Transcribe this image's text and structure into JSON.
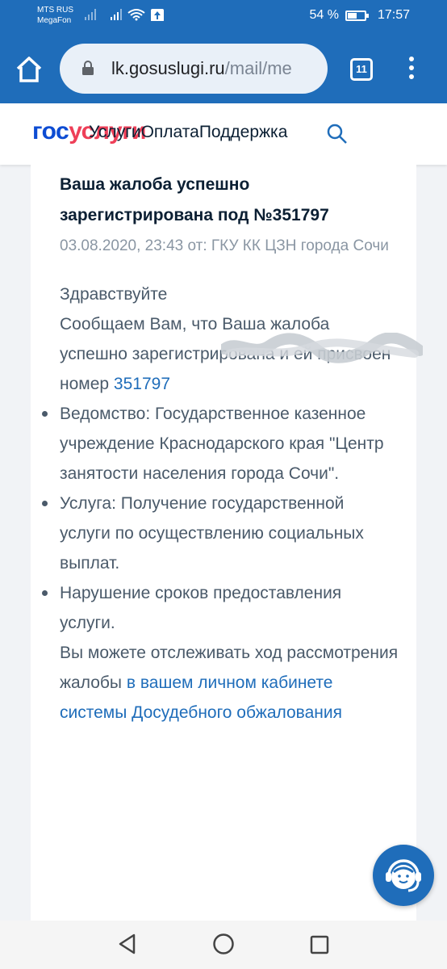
{
  "status_bar": {
    "carrier_1": "MTS RUS",
    "carrier_2": "MegaFon",
    "battery": "54 %",
    "battery_level": 0.54,
    "time": "17:57",
    "icons": [
      "signal-icon",
      "wifi-icon",
      "upload-notification-icon",
      "battery-icon"
    ]
  },
  "browser": {
    "url_host": "lk.gosuslugi.ru",
    "url_path": "/mail/mе",
    "tab_count": "11",
    "icons": [
      "home-icon",
      "lock-icon",
      "tabs-icon",
      "menu-icon"
    ]
  },
  "site_header": {
    "logo_gos": "гос",
    "logo_uslugi": "услуги",
    "nav_text": "УслугиОплатаПоддержка"
  },
  "message": {
    "title": "Ваша жалоба успешно зарегистрирована под №351797",
    "meta": "03.08.2020, 23:43 от: ГКУ КК ЦЗН города Сочи",
    "greeting": "Здравствуйте",
    "intro": "Сообщаем Вам, что Ваша жалоба успешно зарегистрирована и ей присвоен номер",
    "complaint_number": "351797",
    "bullets": [
      "Ведомство: Государственное казенное учреждение Краснодарского края \"Центр занятости населения города Сочи\".",
      "Услуга: Получение государственной услуги по осуществлению социальных выплат.",
      "Нарушение сроков предоставления услуги."
    ],
    "tracking_text": "Вы можете отслеживать ход рассмотрения жалобы",
    "tracking_link": "в вашем личном кабинете системы Досудебного обжалования"
  },
  "colors": {
    "brand_blue": "#1f6dba",
    "logo_blue": "#0d4cd3",
    "logo_red": "#ee3f58",
    "link": "#1f6dba"
  }
}
